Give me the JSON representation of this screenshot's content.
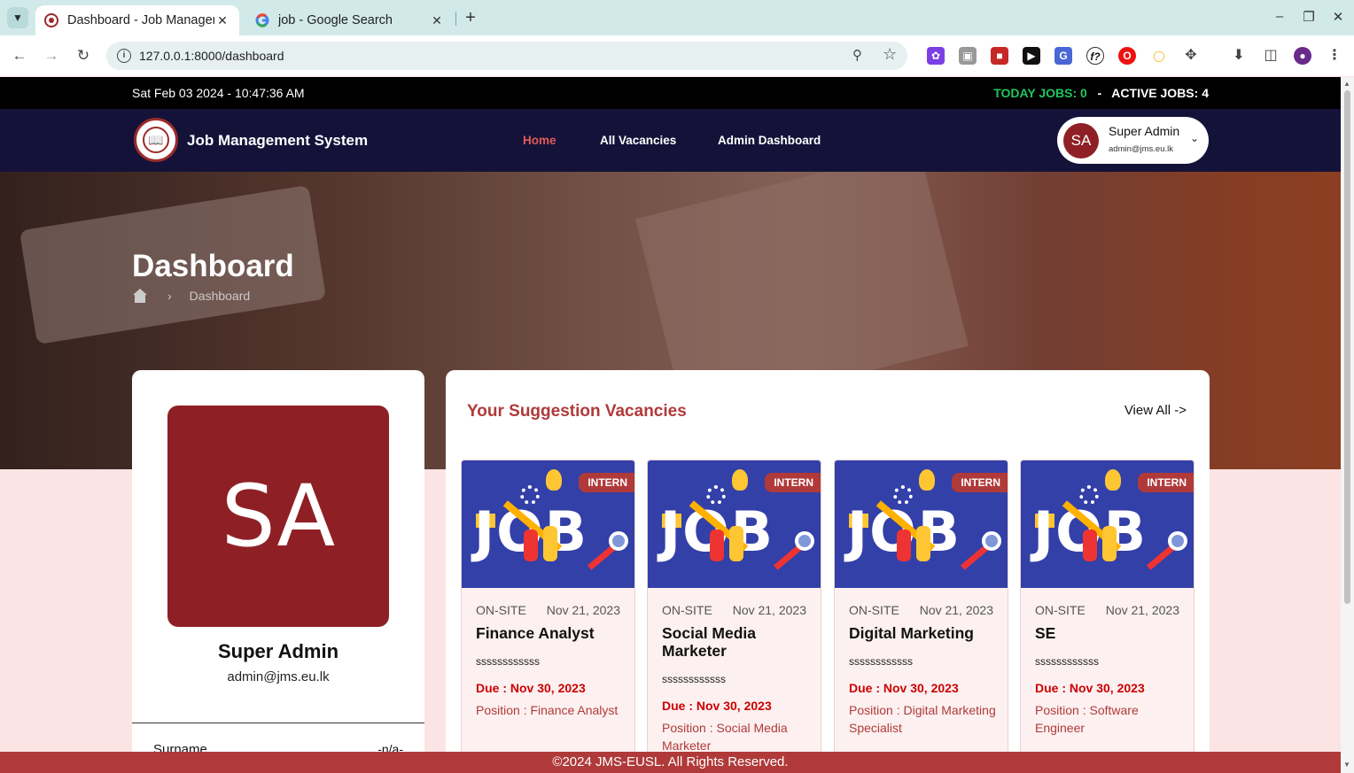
{
  "browser": {
    "tabs": [
      {
        "title": "Dashboard - Job Management System",
        "active": true
      },
      {
        "title": "job - Google Search",
        "active": false
      }
    ],
    "url": "127.0.0.1:8000/dashboard"
  },
  "topbar": {
    "datetime": "Sat Feb 03 2024 - 10:47:36 AM",
    "today_jobs": "TODAY JOBS: 0",
    "separator": "-",
    "active_jobs": "ACTIVE JOBS: 4"
  },
  "navbar": {
    "brand": "Job Management System",
    "links": [
      "Home",
      "All Vacancies",
      "Admin Dashboard"
    ],
    "user": {
      "initials": "SA",
      "name": "Super Admin",
      "email": "admin@jms.eu.lk"
    }
  },
  "hero": {
    "title": "Dashboard",
    "breadcrumb": "Dashboard"
  },
  "profile": {
    "initials": "SA",
    "name": "Super Admin",
    "email": "admin@jms.eu.lk",
    "field_label": "Surname",
    "field_value": "-n/a-"
  },
  "vacancies": {
    "title": "Your Suggestion Vacancies",
    "view_all": "View All ->",
    "cards": [
      {
        "badge": "INTERN",
        "mode": "ON-SITE",
        "date": "Nov 21, 2023",
        "title": "Finance Analyst",
        "desc": "ssssssssssss",
        "due": "Due : Nov 30, 2023",
        "position": "Position :  Finance Analyst"
      },
      {
        "badge": "INTERN",
        "mode": "ON-SITE",
        "date": "Nov 21, 2023",
        "title": "Social Media Marketer",
        "desc": "ssssssssssss",
        "due": "Due : Nov 30, 2023",
        "position": "Position :  Social Media Marketer"
      },
      {
        "badge": "INTERN",
        "mode": "ON-SITE",
        "date": "Nov 21, 2023",
        "title": "Digital Marketing",
        "desc": "ssssssssssss",
        "due": "Due : Nov 30, 2023",
        "position": "Position :  Digital Marketing Specialist"
      },
      {
        "badge": "INTERN",
        "mode": "ON-SITE",
        "date": "Nov 21, 2023",
        "title": "SE",
        "desc": "ssssssssssss",
        "due": "Due : Nov 30, 2023",
        "position": "Position :  Software Engineer"
      }
    ],
    "image_text": "JOB"
  },
  "footer": "©2024  JMS-EUSL.  All Rights Reserved.",
  "colors": {
    "accent": "#b03a3a",
    "navbar": "#141238",
    "avatar": "#8e2025",
    "today": "#22c55e"
  }
}
